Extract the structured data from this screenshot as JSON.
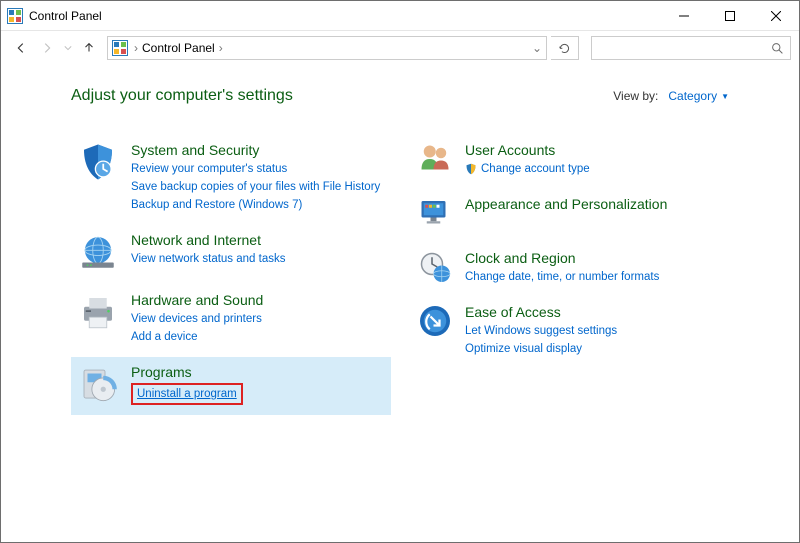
{
  "window": {
    "title": "Control Panel"
  },
  "breadcrumb": {
    "label": "Control Panel"
  },
  "header": {
    "heading": "Adjust your computer's settings",
    "viewby_label": "View by:",
    "viewby_value": "Category"
  },
  "left": {
    "system": {
      "title": "System and Security",
      "link1": "Review your computer's status",
      "link2": "Save backup copies of your files with File History",
      "link3": "Backup and Restore (Windows 7)"
    },
    "network": {
      "title": "Network and Internet",
      "link1": "View network status and tasks"
    },
    "hardware": {
      "title": "Hardware and Sound",
      "link1": "View devices and printers",
      "link2": "Add a device"
    },
    "programs": {
      "title": "Programs",
      "link1": "Uninstall a program"
    }
  },
  "right": {
    "users": {
      "title": "User Accounts",
      "link1": "Change account type"
    },
    "appearance": {
      "title": "Appearance and Personalization"
    },
    "clock": {
      "title": "Clock and Region",
      "link1": "Change date, time, or number formats"
    },
    "ease": {
      "title": "Ease of Access",
      "link1": "Let Windows suggest settings",
      "link2": "Optimize visual display"
    }
  }
}
